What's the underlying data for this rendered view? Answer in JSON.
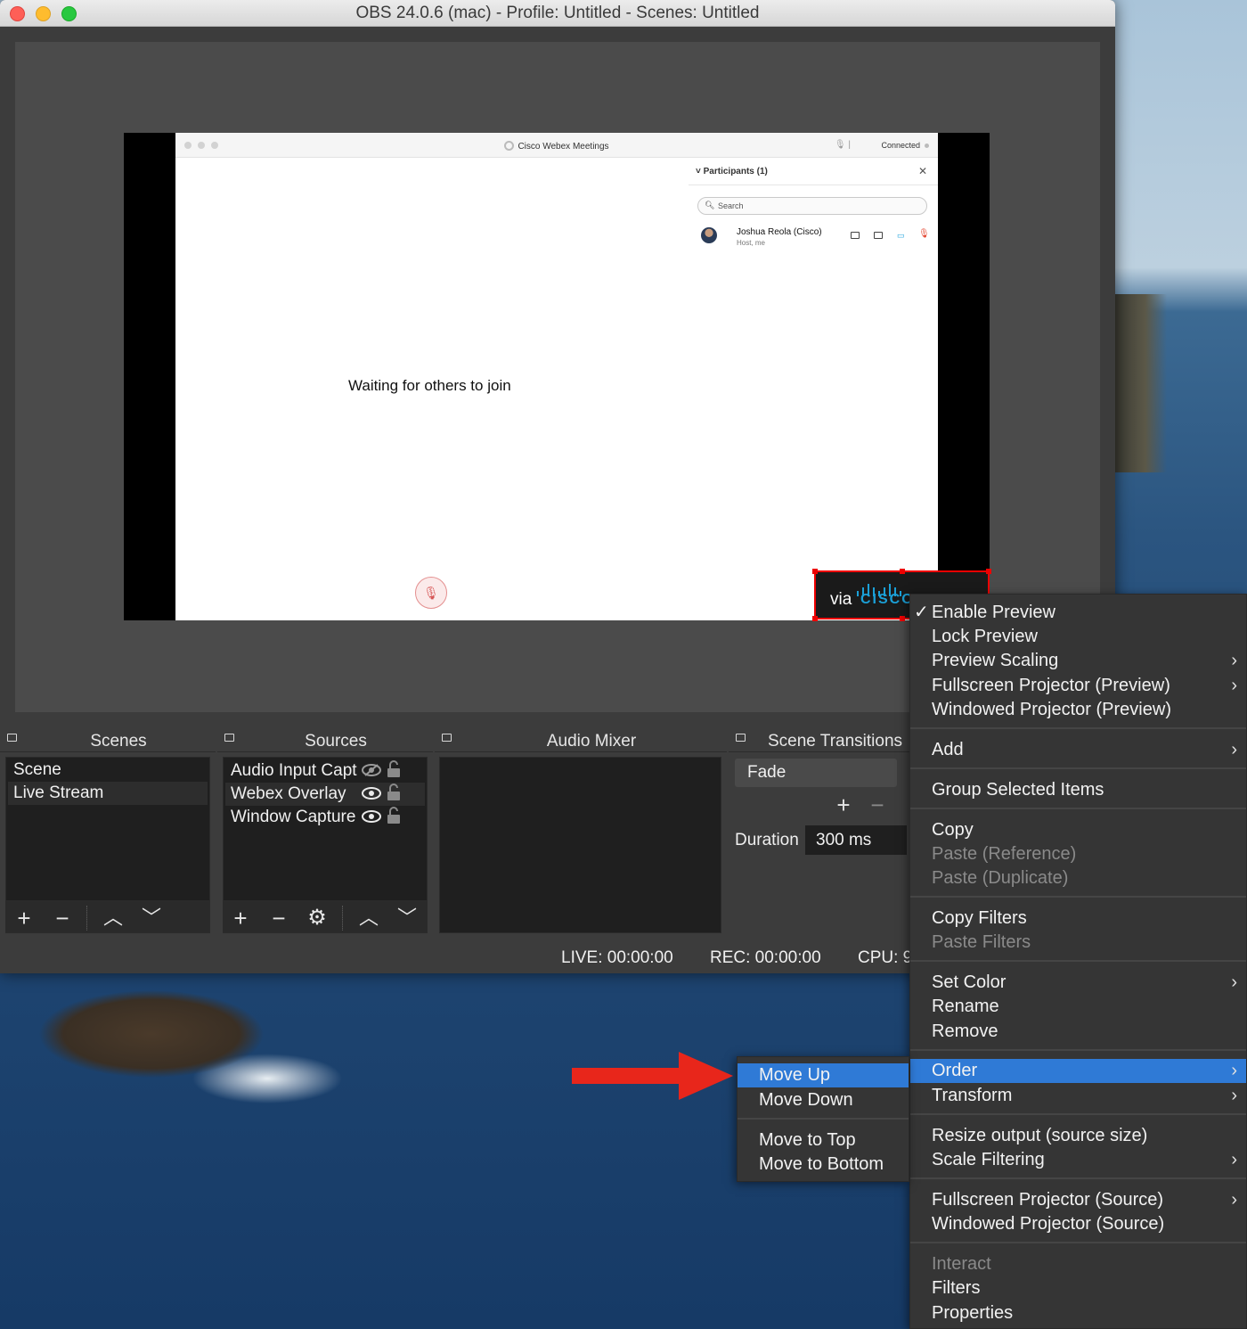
{
  "window": {
    "title": "OBS 24.0.6 (mac) - Profile: Untitled - Scenes: Untitled"
  },
  "preview": {
    "webex": {
      "app_title": "Cisco Webex Meetings",
      "connected": "Connected",
      "participants_header": "Participants (1)",
      "search_placeholder": "Search",
      "participant_name": "Joshua Reola (Cisco)",
      "participant_role": "Host, me",
      "waiting_text": "Waiting for others to join"
    },
    "overlay": {
      "via": "via",
      "brand": "CISCO"
    }
  },
  "docks": {
    "scenes": {
      "title": "Scenes",
      "items": [
        "Scene",
        "Live Stream"
      ]
    },
    "sources": {
      "title": "Sources",
      "items": [
        "Audio Input Capt",
        "Webex Overlay",
        "Window Capture"
      ]
    },
    "audio_mixer": {
      "title": "Audio Mixer"
    },
    "scene_transitions": {
      "title": "Scene Transitions",
      "selected": "Fade",
      "duration_label": "Duration",
      "duration_value": "300 ms"
    }
  },
  "status": {
    "live": "LIVE: 00:00:00",
    "rec": "REC: 00:00:00",
    "cpu": "CPU: 9"
  },
  "context_menu": {
    "items": [
      {
        "label": "Enable Preview",
        "checked": true
      },
      {
        "label": "Lock Preview"
      },
      {
        "label": "Preview Scaling",
        "submenu": true
      },
      {
        "label": "Fullscreen Projector (Preview)",
        "submenu": true
      },
      {
        "label": "Windowed Projector (Preview)"
      },
      {
        "label": "Add",
        "submenu": true
      },
      {
        "label": "Group Selected Items"
      },
      {
        "label": "Copy"
      },
      {
        "label": "Paste (Reference)",
        "disabled": true
      },
      {
        "label": "Paste (Duplicate)",
        "disabled": true
      },
      {
        "label": "Copy Filters"
      },
      {
        "label": "Paste Filters",
        "disabled": true
      },
      {
        "label": "Set Color",
        "submenu": true
      },
      {
        "label": "Rename"
      },
      {
        "label": "Remove"
      },
      {
        "label": "Order",
        "submenu": true,
        "highlighted": true
      },
      {
        "label": "Transform",
        "submenu": true
      },
      {
        "label": "Resize output (source size)"
      },
      {
        "label": "Scale Filtering",
        "submenu": true
      },
      {
        "label": "Fullscreen Projector (Source)",
        "submenu": true
      },
      {
        "label": "Windowed Projector (Source)"
      },
      {
        "label": "Interact",
        "disabled": true
      },
      {
        "label": "Filters"
      },
      {
        "label": "Properties"
      }
    ]
  },
  "order_submenu": {
    "items": [
      {
        "label": "Move Up",
        "highlighted": true
      },
      {
        "label": "Move Down"
      },
      {
        "label": "Move to Top"
      },
      {
        "label": "Move to Bottom"
      }
    ]
  },
  "colors": {
    "highlight": "#2f7ad6",
    "selection_border": "#ee0000",
    "arrow": "#e8261b",
    "cisco_blue": "#1ba0d7"
  }
}
